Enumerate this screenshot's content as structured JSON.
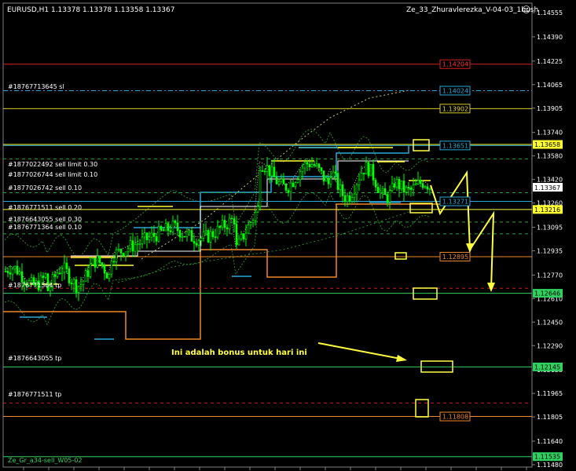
{
  "header": {
    "symbol_line": "EURUSD,H1  1.13378 1.13378 1.13358 1.13367",
    "expert_name": "Ze_33_Zhuravlerezka_V-04-03_1bush",
    "smiley": "☺"
  },
  "price_axis": {
    "ticks": [
      "1.14555",
      "1.14390",
      "1.14225",
      "1.14065",
      "1.13905",
      "1.13740",
      "1.13580",
      "1.13420",
      "1.13260",
      "1.13095",
      "1.12935",
      "1.12770",
      "1.12610",
      "1.12450",
      "1.12290",
      "1.12125",
      "1.11965",
      "1.11805",
      "1.11640",
      "1.11480"
    ],
    "current_price": "1.13367",
    "current_price_color": "#cc0000"
  },
  "levels": [
    {
      "value": "1.14204",
      "color": "#d22020",
      "text_color": "#ff3030"
    },
    {
      "value": "1.14024",
      "color": "#2aa8d8",
      "text_color": "#2aa8d8"
    },
    {
      "value": "1.13902",
      "color": "#d8c828",
      "text_color": "#e8d838"
    },
    {
      "value": "1.13651",
      "color": "#2aa8d8",
      "text_color": "#2aa8d8"
    },
    {
      "value": "1.13658",
      "color": "#ffff30",
      "text_color": "#000000"
    },
    {
      "value": "1.13271",
      "color": "#2aa8d8",
      "text_color": "#2aa8d8"
    },
    {
      "value": "1.13216",
      "color": "#ffff30",
      "text_color": "#000000"
    },
    {
      "value": "1.12895",
      "color": "#f08828",
      "text_color": "#f08828"
    },
    {
      "value": "1.12646",
      "color": "#30d060",
      "text_color": "#000000"
    },
    {
      "value": "1.12145",
      "color": "#30d060",
      "text_color": "#000000"
    },
    {
      "value": "1.11808",
      "color": "#f08828",
      "text_color": "#f08828"
    },
    {
      "value": "1.11535",
      "color": "#30d060",
      "text_color": "#000000"
    }
  ],
  "order_labels": [
    "#18767713645 sl",
    "#1877022492 sell limit 0.30",
    "#1877026744 sell limit 0.10",
    "#1877026742 sell 0.10",
    "#1876771511 sell 0.20",
    "#1876643055 sell 0.30",
    "#1876771364 sell 0.10",
    "#1876771364 tp",
    "#1876643055 tp",
    "#1876771511 tp",
    "Ze_Gr_a34-sell_W05-02"
  ],
  "annotation": "Ini adalah bonus untuk hari ini",
  "colors": {
    "background": "#000000",
    "candle": "#00ff00",
    "bands": "#2a8a2a",
    "orange_line": "#f08828",
    "yellow_line": "#ffff30",
    "blue_line": "#2aa8d8",
    "annotation": "#ffff40"
  }
}
